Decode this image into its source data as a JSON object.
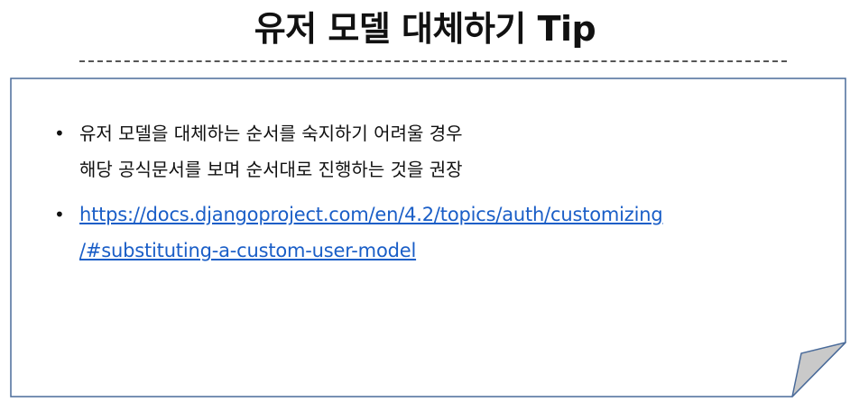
{
  "title": "유저 모델 대체하기 Tip",
  "bullets": {
    "item1": {
      "line1": "유저 모델을 대체하는 순서를 숙지하기 어려울 경우",
      "line2": "해당 공식문서를 보며 순서대로 진행하는 것을 권장"
    },
    "item2": {
      "link_line1": "https://docs.djangoproject.com/en/4.2/topics/auth/customizing",
      "link_line2": "/#substituting-a-custom-user-model",
      "href": "https://docs.djangoproject.com/en/4.2/topics/auth/customizing/#substituting-a-custom-user-model"
    },
    "bullet_char": "•"
  },
  "colors": {
    "link": "#1a5ec7",
    "card_border": "#4a6b9a",
    "fold_fill": "#c9c9c9",
    "text": "#111111"
  }
}
